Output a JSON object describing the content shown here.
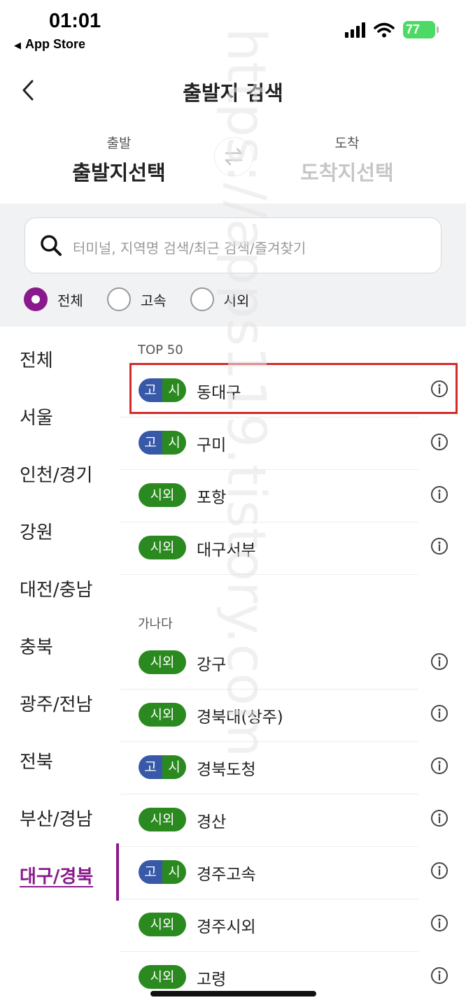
{
  "status_bar": {
    "time": "01:01",
    "back_app": "App Store",
    "battery": "77"
  },
  "header": {
    "title": "출발지 검색"
  },
  "route": {
    "departure_label": "출발",
    "departure_value": "출발지선택",
    "arrival_label": "도착",
    "arrival_value": "도착지선택"
  },
  "search": {
    "placeholder": "터미널, 지역명 검색/최근 검색/즐겨찾기"
  },
  "filters": [
    {
      "label": "전체",
      "selected": true
    },
    {
      "label": "고속",
      "selected": false
    },
    {
      "label": "시외",
      "selected": false
    }
  ],
  "regions": [
    "전체",
    "서울",
    "인천/경기",
    "강원",
    "대전/충남",
    "충북",
    "광주/전남",
    "전북",
    "부산/경남",
    "대구/경북"
  ],
  "active_region": "대구/경북",
  "sections": [
    {
      "title": "TOP 50",
      "items": [
        {
          "type": "both",
          "tag_ko": "고",
          "tag_si": "시",
          "name": "동대구"
        },
        {
          "type": "both",
          "tag_ko": "고",
          "tag_si": "시",
          "name": "구미"
        },
        {
          "type": "siwoe",
          "tag": "시외",
          "name": "포항"
        },
        {
          "type": "siwoe",
          "tag": "시외",
          "name": "대구서부"
        }
      ]
    },
    {
      "title": "가나다",
      "items": [
        {
          "type": "siwoe",
          "tag": "시외",
          "name": "강구"
        },
        {
          "type": "siwoe",
          "tag": "시외",
          "name": "경북대(상주)"
        },
        {
          "type": "both",
          "tag_ko": "고",
          "tag_si": "시",
          "name": "경북도청"
        },
        {
          "type": "siwoe",
          "tag": "시외",
          "name": "경산"
        },
        {
          "type": "both",
          "tag_ko": "고",
          "tag_si": "시",
          "name": "경주고속"
        },
        {
          "type": "siwoe",
          "tag": "시외",
          "name": "경주시외"
        },
        {
          "type": "siwoe",
          "tag": "시외",
          "name": "고령"
        }
      ]
    }
  ],
  "watermark": "https://apps119.tistory.com",
  "colors": {
    "accent": "#8a1a8c",
    "express_tag": "#3858a8",
    "intercity_tag": "#2a8a1f",
    "highlight": "#d42a2a"
  }
}
